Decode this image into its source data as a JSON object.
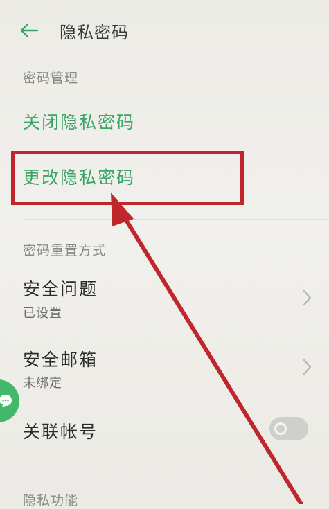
{
  "header": {
    "title": "隐私密码",
    "back_icon": "arrow-left-icon"
  },
  "sections": {
    "password_management": {
      "header": "密码管理",
      "items": [
        {
          "label": "关闭隐私密码"
        },
        {
          "label": "更改隐私密码"
        }
      ]
    },
    "reset_method": {
      "header": "密码重置方式",
      "security_question": {
        "title": "安全问题",
        "status": "已设置"
      },
      "security_email": {
        "title": "安全邮箱",
        "status": "未绑定"
      },
      "linked_account": {
        "title": "关联帐号",
        "toggle_on": false
      }
    },
    "privacy_features": {
      "header": "隐私功能"
    }
  },
  "colors": {
    "accent": "#3ba567",
    "annotation": "#c0272d"
  }
}
